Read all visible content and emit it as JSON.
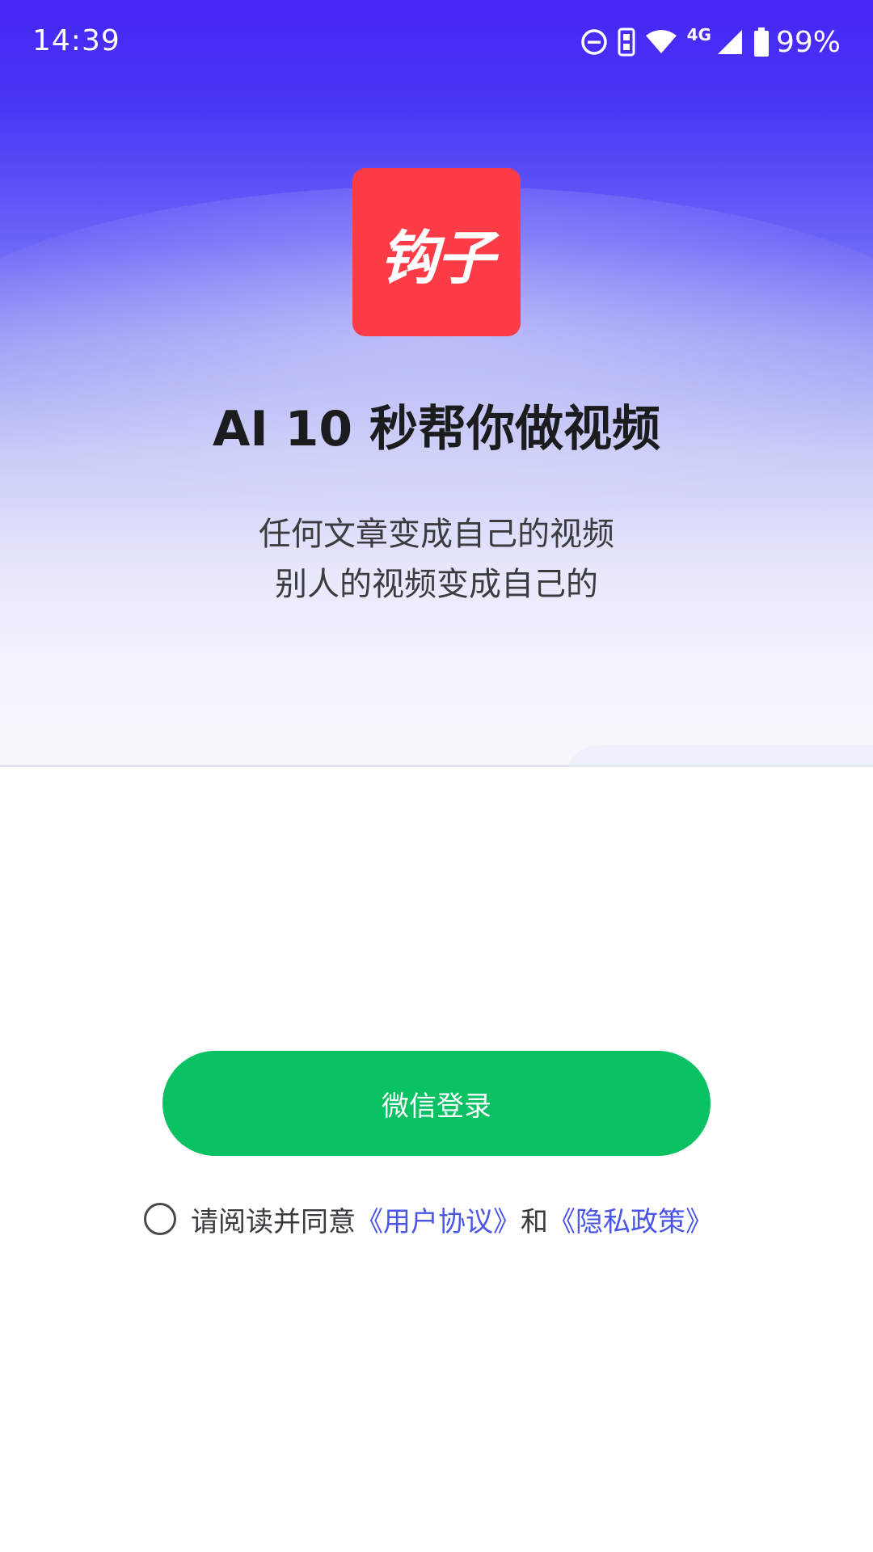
{
  "status_bar": {
    "time": "14:39",
    "battery_percent": "99%",
    "network_label": "4G",
    "icons": [
      "do-not-disturb-icon",
      "sim-hd-icon",
      "wifi-icon",
      "cellular-signal-icon",
      "battery-icon"
    ]
  },
  "hero": {
    "logo_text": "钩子",
    "logo_color": "#fd3c48",
    "headline": "AI 10 秒帮你做视频",
    "subtitle_line1": "任何文章变成自己的视频",
    "subtitle_line2": "别人的视频变成自己的",
    "gradient_top": "#4526f4"
  },
  "login": {
    "button_label": "微信登录",
    "button_color": "#0ac163"
  },
  "agreement": {
    "checked": false,
    "prefix": "请阅读并同意",
    "user_agreement": "《用户协议》",
    "conjunction": "和",
    "privacy_policy": "《隐私政策》",
    "link_color": "#4b55e8"
  }
}
